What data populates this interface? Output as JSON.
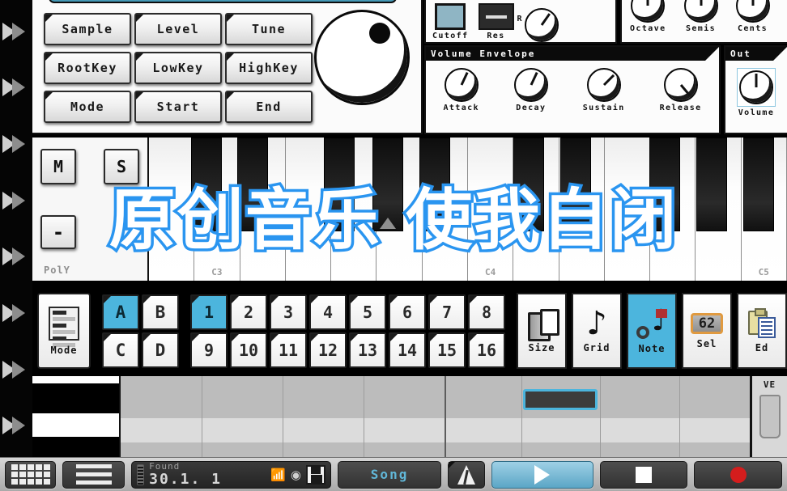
{
  "overlay": {
    "text": "原创音乐 使我自闭"
  },
  "instrument_panel": {
    "buttons": [
      "Sample",
      "Level",
      "Tune",
      "RootKey",
      "LowKey",
      "HighKey",
      "Mode",
      "Start",
      "End"
    ],
    "big_knob_name": "main-dial"
  },
  "filter_section": {
    "cutoff_label": "Cutoff",
    "res_label": "Res",
    "r_label": "R",
    "r_knob_angle": 135
  },
  "pitch_section": {
    "knobs": [
      {
        "label": "Octave",
        "angle": 0
      },
      {
        "label": "Semis",
        "angle": 0
      },
      {
        "label": "Cents",
        "angle": 0
      }
    ]
  },
  "volume_envelope": {
    "title": "Volume Envelope",
    "knobs": [
      {
        "label": "Attack",
        "angle": 205
      },
      {
        "label": "Decay",
        "angle": 205
      },
      {
        "label": "Sustain",
        "angle": 225
      },
      {
        "label": "Release",
        "angle": 320
      }
    ]
  },
  "out_section": {
    "title": "Out",
    "knob": {
      "label": "Volume",
      "angle": 0
    }
  },
  "keyboard": {
    "mute_label": "M",
    "solo_label": "S",
    "minus_label": "-",
    "side_label": "PolY",
    "white_key_labels": [
      "",
      "C3",
      "",
      "",
      "",
      "",
      "",
      "C4",
      "",
      "",
      "",
      "",
      "",
      "C5",
      "",
      ""
    ]
  },
  "pad_section": {
    "mode_label": "Mode",
    "bank_pads": [
      "A",
      "B",
      "C",
      "D"
    ],
    "bank_active": "A",
    "step_pads": [
      "1",
      "2",
      "3",
      "4",
      "5",
      "6",
      "7",
      "8",
      "9",
      "10",
      "11",
      "12",
      "13",
      "14",
      "15",
      "16"
    ],
    "step_active": "1",
    "tools": [
      {
        "label": "Size",
        "icon": "copy-icon",
        "active": false
      },
      {
        "label": "Grid",
        "icon": "note-icon",
        "active": false
      },
      {
        "label": "Note",
        "icon": "note-gear-icon",
        "active": true
      },
      {
        "label": "Sel",
        "icon": "selection-count-icon",
        "value": "62",
        "active": false
      },
      {
        "label": "Ed",
        "icon": "clipboard-icon",
        "active": false
      }
    ]
  },
  "piano_roll": {
    "note_label": "note-block",
    "velocity_title": "VE"
  },
  "transport": {
    "grid_button": "grid-view-icon",
    "menu_button": "menu-icon",
    "display": {
      "status": "Found",
      "position": "30.1. 1",
      "wifi_icon": "wifi-icon",
      "midi_icon": "midi-icon",
      "save_icon": "save-icon"
    },
    "song_label": "Song",
    "metronome_label": "metronome-icon",
    "play_label": "play-icon",
    "stop_label": "stop-icon",
    "record_label": "record-icon"
  },
  "colors": {
    "accent_blue": "#4cb5dd",
    "overlay_stroke": "#2a95f0",
    "record_red": "#d41d1d",
    "sel_orange": "#e09a40"
  }
}
